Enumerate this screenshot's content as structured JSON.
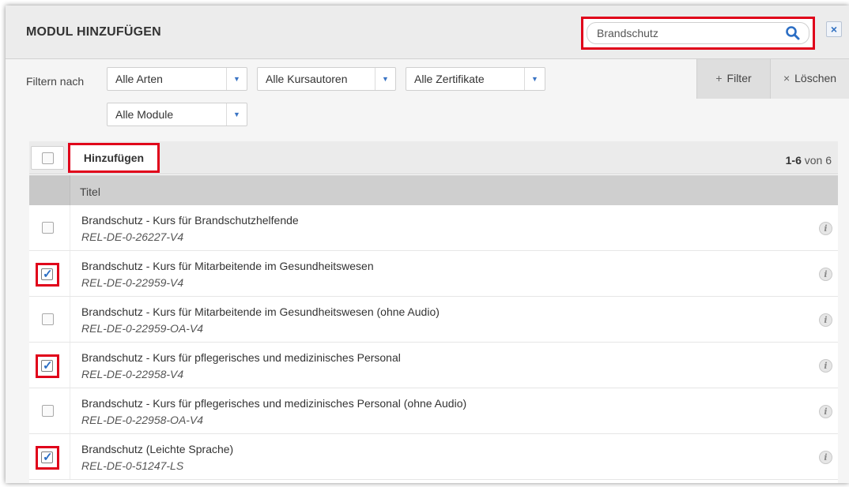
{
  "header": {
    "title": "MODUL HINZUFÜGEN",
    "search_value": "Brandschutz",
    "close_symbol": "×"
  },
  "filters": {
    "label": "Filtern nach",
    "selects": [
      {
        "value": "Alle Arten"
      },
      {
        "value": "Alle Kursautoren"
      },
      {
        "value": "Alle Zertifikate"
      },
      {
        "value": "Alle Module"
      }
    ],
    "filter_button": "Filter",
    "clear_button": "Löschen"
  },
  "toolbar": {
    "add_button": "Hinzufügen",
    "count_range": "1-6",
    "count_suffix": " von 6"
  },
  "table": {
    "column_title": "Titel",
    "rows": [
      {
        "title": "Brandschutz - Kurs für Brandschutzhelfende",
        "code": "REL-DE-0-26227-V4",
        "checked": false
      },
      {
        "title": "Brandschutz - Kurs für Mitarbeitende im Gesundheitswesen",
        "code": "REL-DE-0-22959-V4",
        "checked": true
      },
      {
        "title": "Brandschutz - Kurs für Mitarbeitende im Gesundheitswesen (ohne Audio)",
        "code": "REL-DE-0-22959-OA-V4",
        "checked": false
      },
      {
        "title": "Brandschutz - Kurs für pflegerisches und medizinisches Personal",
        "code": "REL-DE-0-22958-V4",
        "checked": true
      },
      {
        "title": "Brandschutz - Kurs für pflegerisches und medizinisches Personal (ohne Audio)",
        "code": "REL-DE-0-22958-OA-V4",
        "checked": false
      },
      {
        "title": "Brandschutz (Leichte Sprache)",
        "code": "REL-DE-0-51247-LS",
        "checked": true
      }
    ]
  },
  "colors": {
    "highlight": "#e0001a",
    "accent": "#2b6ec4"
  },
  "icons": {
    "search": "search-icon",
    "close": "close-icon",
    "info": "info-icon",
    "dropdown": "chevron-down-icon"
  }
}
